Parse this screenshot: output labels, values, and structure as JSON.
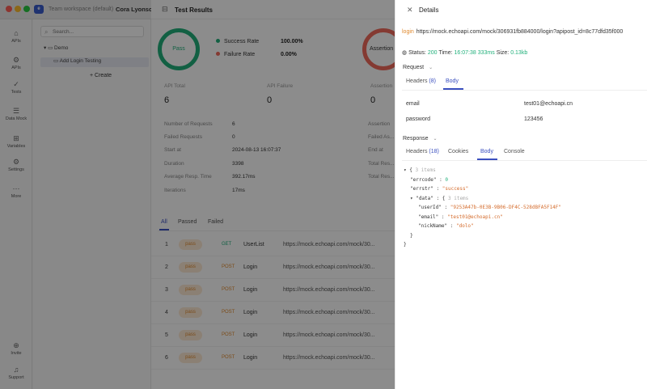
{
  "window": {
    "workspace": "Team workspace (default)",
    "separator": "/",
    "project": "Cora Lyonscott"
  },
  "rail": [
    {
      "icon": "apis-icon",
      "glyph": "⌂",
      "label": "APIs"
    },
    {
      "icon": "apis-icon",
      "glyph": "⚙",
      "label": "APIs"
    },
    {
      "icon": "tests-icon",
      "glyph": "✓",
      "label": "Tests"
    },
    {
      "icon": "docs-icon",
      "glyph": "☰",
      "label": "Data Mock"
    },
    {
      "icon": "variables-icon",
      "glyph": "⊞",
      "label": "Variables"
    },
    {
      "icon": "settings-icon",
      "glyph": "⚙",
      "label": "Settings"
    },
    {
      "icon": "more-icon",
      "glyph": "⋯",
      "label": "More"
    },
    {
      "icon": "invite-icon",
      "glyph": "⊕",
      "label": "Invite"
    },
    {
      "icon": "support-icon",
      "glyph": "♫",
      "label": "Support"
    }
  ],
  "tree": {
    "search_placeholder": "Search...",
    "items": [
      "Demo",
      "Add Login Testing"
    ],
    "create_label": "+ Create"
  },
  "results": {
    "title": "Test Results",
    "pass_label": "Pass",
    "success_rate_label": "Success Rate",
    "success_rate": "100.00%",
    "failure_rate_label": "Failure Rate",
    "failure_rate": "0.00%",
    "assertion_label": "Assertion",
    "stats": [
      {
        "label": "API Total",
        "value": "6"
      },
      {
        "label": "API Failure",
        "value": "0"
      },
      {
        "label": "Assertion",
        "value": "0"
      }
    ],
    "info": [
      {
        "label": "Number of Requests",
        "value": "6"
      },
      {
        "label": "Failed Requests",
        "value": "0"
      },
      {
        "label": "Start at",
        "value": "2024-08-13 16:07:37"
      },
      {
        "label": "Duration",
        "value": "3398"
      },
      {
        "label": "Average Resp. Time",
        "value": "392.17ms"
      },
      {
        "label": "Iterations",
        "value": "17ms"
      }
    ],
    "info_right": [
      "Assertion",
      "Failed As...",
      "End at",
      "Total Res...",
      "Total Res..."
    ],
    "filter_tabs": [
      "All",
      "Passed",
      "Failed"
    ],
    "rows": [
      {
        "num": "1",
        "badge": "pass",
        "method": "GET",
        "method_color": "#21b07b",
        "name": "UserList",
        "url": "https://mock.echoapi.com/mock/30..."
      },
      {
        "num": "2",
        "badge": "pass",
        "method": "POST",
        "method_color": "#e08a2e",
        "name": "Login",
        "url": "https://mock.echoapi.com/mock/30..."
      },
      {
        "num": "3",
        "badge": "pass",
        "method": "POST",
        "method_color": "#e08a2e",
        "name": "Login",
        "url": "https://mock.echoapi.com/mock/30..."
      },
      {
        "num": "4",
        "badge": "pass",
        "method": "POST",
        "method_color": "#e08a2e",
        "name": "Login",
        "url": "https://mock.echoapi.com/mock/30..."
      },
      {
        "num": "5",
        "badge": "pass",
        "method": "POST",
        "method_color": "#e08a2e",
        "name": "Login",
        "url": "https://mock.echoapi.com/mock/30..."
      },
      {
        "num": "6",
        "badge": "pass",
        "method": "POST",
        "method_color": "#e08a2e",
        "name": "Login",
        "url": "https://mock.echoapi.com/mock/30..."
      }
    ]
  },
  "details": {
    "title": "Details",
    "method": "login",
    "url": "https://mock.echoapi.com/mock/306931fb884000/login?apipost_id=8c77dfd35f000",
    "status_label": "Status:",
    "status_value": "200",
    "time_label": "Time:",
    "time_value": "16:07:38 333ms",
    "size_label": "Size:",
    "size_value": "0.13kb",
    "request_label": "Request",
    "request_tabs": [
      {
        "label": "Headers",
        "count": "(8)"
      },
      {
        "label": "Body",
        "count": ""
      }
    ],
    "body_rows": [
      {
        "key": "email",
        "value": "test01@echoapi.cn"
      },
      {
        "key": "password",
        "value": "123456"
      }
    ],
    "response_label": "Response",
    "response_tabs": [
      {
        "label": "Headers",
        "count": "(18)"
      },
      {
        "label": "Cookies",
        "count": ""
      },
      {
        "label": "Body",
        "count": ""
      },
      {
        "label": "Console",
        "count": ""
      }
    ],
    "json_lines": [
      {
        "text": "▾ {",
        "comment": "3 items"
      },
      {
        "key": "\"errcode\"",
        "val": "0",
        "type": "num"
      },
      {
        "key": "\"errstr\"",
        "val": "\"success\"",
        "type": "str"
      },
      {
        "key": "▾ \"data\"",
        "val": "{",
        "type": "plain",
        "comment": "3 items"
      },
      {
        "key": "\"userId\"",
        "val": "\"9253A47b-0E3B-9B06-DF4C-528dBFA5F14F\"",
        "type": "str"
      },
      {
        "key": "\"email\"",
        "val": "\"test01@echoapi.cn\"",
        "type": "str"
      },
      {
        "key": "\"nickName\"",
        "val": "\"dolo\"",
        "type": "str"
      },
      {
        "text": "}"
      },
      {
        "text": "}"
      }
    ]
  }
}
